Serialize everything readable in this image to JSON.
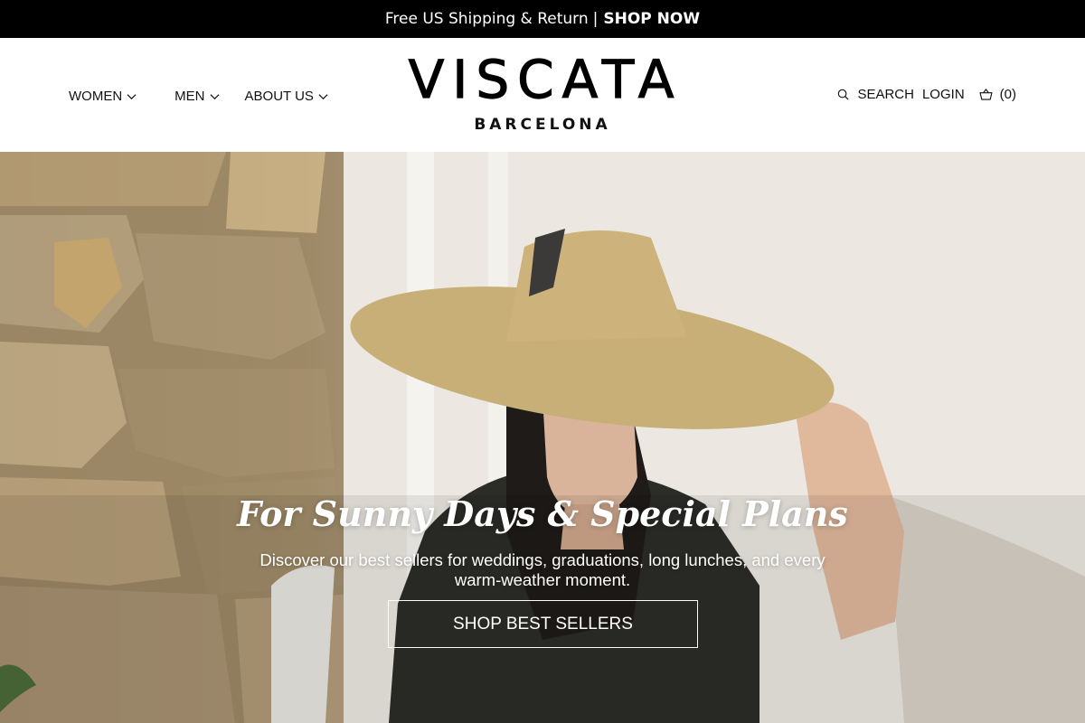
{
  "announcement": {
    "text": "Free US Shipping & Return",
    "separator": "|",
    "link_label": "SHOP NOW"
  },
  "nav_left": {
    "women": "WOMEN",
    "men": "MEN",
    "about": "ABOUT US"
  },
  "logo": {
    "main": "VISCATA",
    "sub": "BARCELONA"
  },
  "nav_right": {
    "search": "SEARCH",
    "login": "LOGIN",
    "cart_count": "(0)"
  },
  "hero": {
    "title": "For Sunny Days & Special Plans",
    "subtitle": "Discover our best sellers for weddings, graduations, long lunches, and every warm-weather moment.",
    "cta_label": "SHOP BEST SELLERS"
  },
  "icons": {
    "search": "search-icon",
    "cart": "basket-icon",
    "chevron": "chevron-down-icon"
  },
  "colors": {
    "announcement_bg": "#000000",
    "text": "#111111",
    "hero_text": "#ffffff"
  }
}
